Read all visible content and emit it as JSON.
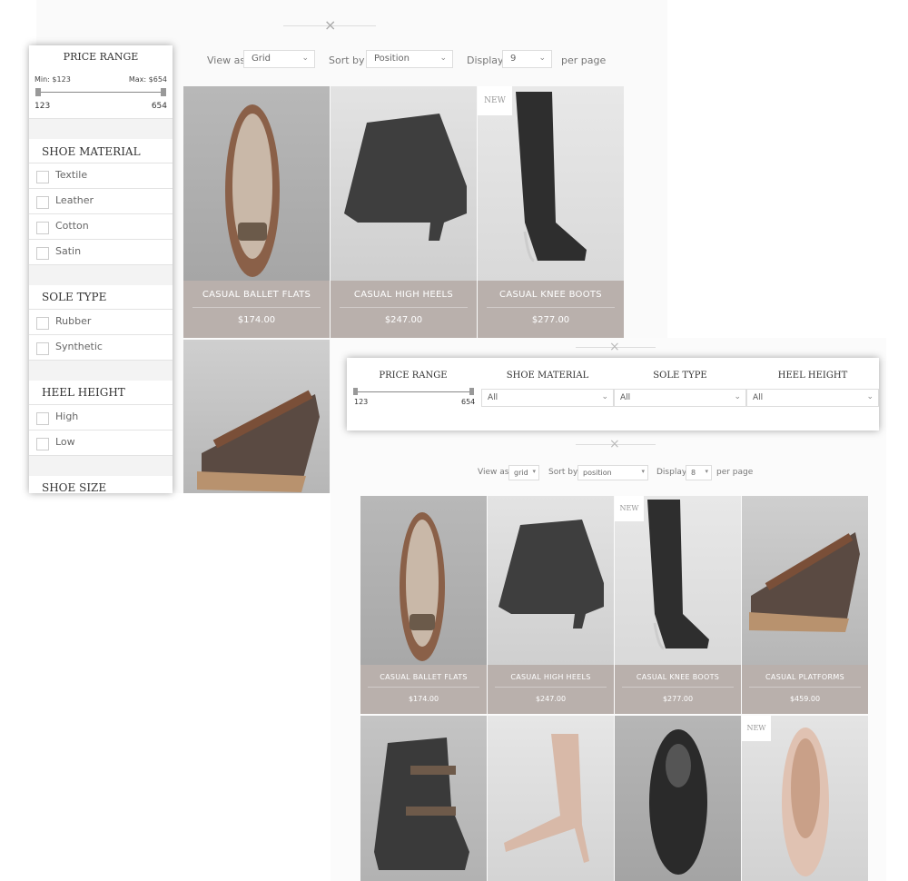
{
  "sidebar_view": {
    "toolbar": {
      "view_label": "View as",
      "view_value": "Grid",
      "sort_label": "Sort by",
      "sort_value": "Position",
      "display_label": "Display",
      "display_value": "9",
      "per_page": "per page"
    },
    "price_range": {
      "title": "PRICE RANGE",
      "min_label": "Min: $123",
      "max_label": "Max: $654",
      "min": "123",
      "max": "654"
    },
    "shoe_material": {
      "title": "SHOE MATERIAL",
      "options": [
        "Textile",
        "Leather",
        "Cotton",
        "Satin"
      ]
    },
    "sole_type": {
      "title": "SOLE TYPE",
      "options": [
        "Rubber",
        "Synthetic"
      ]
    },
    "heel_height": {
      "title": "HEEL HEIGHT",
      "options": [
        "High",
        "Low"
      ]
    },
    "shoe_size": {
      "title": "SHOE SIZE"
    },
    "products": [
      {
        "name": "CASUAL BALLET FLATS",
        "price": "$174.00"
      },
      {
        "name": "CASUAL HIGH HEELS",
        "price": "$247.00"
      },
      {
        "name": "CASUAL KNEE BOOTS",
        "price": "$277.00",
        "badge": "NEW"
      }
    ]
  },
  "topbar_view": {
    "filters": {
      "price_range": {
        "title": "PRICE RANGE",
        "min": "123",
        "max": "654"
      },
      "shoe_material": {
        "title": "SHOE MATERIAL",
        "value": "All"
      },
      "sole_type": {
        "title": "SOLE TYPE",
        "value": "All"
      },
      "heel_height": {
        "title": "HEEL HEIGHT",
        "value": "All"
      }
    },
    "toolbar": {
      "view_label": "View as",
      "view_value": "grid",
      "sort_label": "Sort by",
      "sort_value": "position",
      "display_label": "Display",
      "display_value": "8",
      "per_page": "per page"
    },
    "products": [
      {
        "name": "CASUAL BALLET FLATS",
        "price": "$174.00"
      },
      {
        "name": "CASUAL HIGH HEELS",
        "price": "$247.00"
      },
      {
        "name": "CASUAL KNEE BOOTS",
        "price": "$277.00",
        "badge": "NEW"
      },
      {
        "name": "CASUAL PLATFORMS",
        "price": "$459.00"
      }
    ],
    "row2_badge": "NEW"
  },
  "icons": {
    "close": "×",
    "chevron": "⌄"
  },
  "colors": {
    "caption": "#b9b0ac",
    "accent": "#a89e9a"
  }
}
